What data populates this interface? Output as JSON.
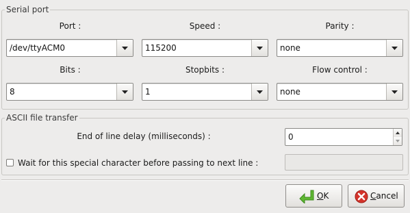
{
  "serial_port": {
    "title": "Serial port",
    "port": {
      "label": "Port :",
      "value": "/dev/ttyACM0"
    },
    "speed": {
      "label": "Speed :",
      "value": "115200"
    },
    "parity": {
      "label": "Parity :",
      "value": "none"
    },
    "bits": {
      "label": "Bits :",
      "value": "8"
    },
    "stopbits": {
      "label": "Stopbits :",
      "value": "1"
    },
    "flow_control": {
      "label": "Flow control :",
      "value": "none"
    }
  },
  "ascii_transfer": {
    "title": "ASCII file transfer",
    "eol_delay": {
      "label": "End of line delay (milliseconds) :",
      "value": "0"
    },
    "wait_char": {
      "label": "Wait for this special character before passing to next line :",
      "checked": false,
      "value": ""
    }
  },
  "buttons": {
    "ok": {
      "mnemonic": "O",
      "rest": "K",
      "icon": "ok-arrow-icon"
    },
    "cancel": {
      "mnemonic": "C",
      "rest": "ancel",
      "icon": "cancel-icon"
    }
  },
  "colors": {
    "ok_icon": "#5fb832",
    "cancel_icon": "#d4342b",
    "background": "#edeceb"
  }
}
